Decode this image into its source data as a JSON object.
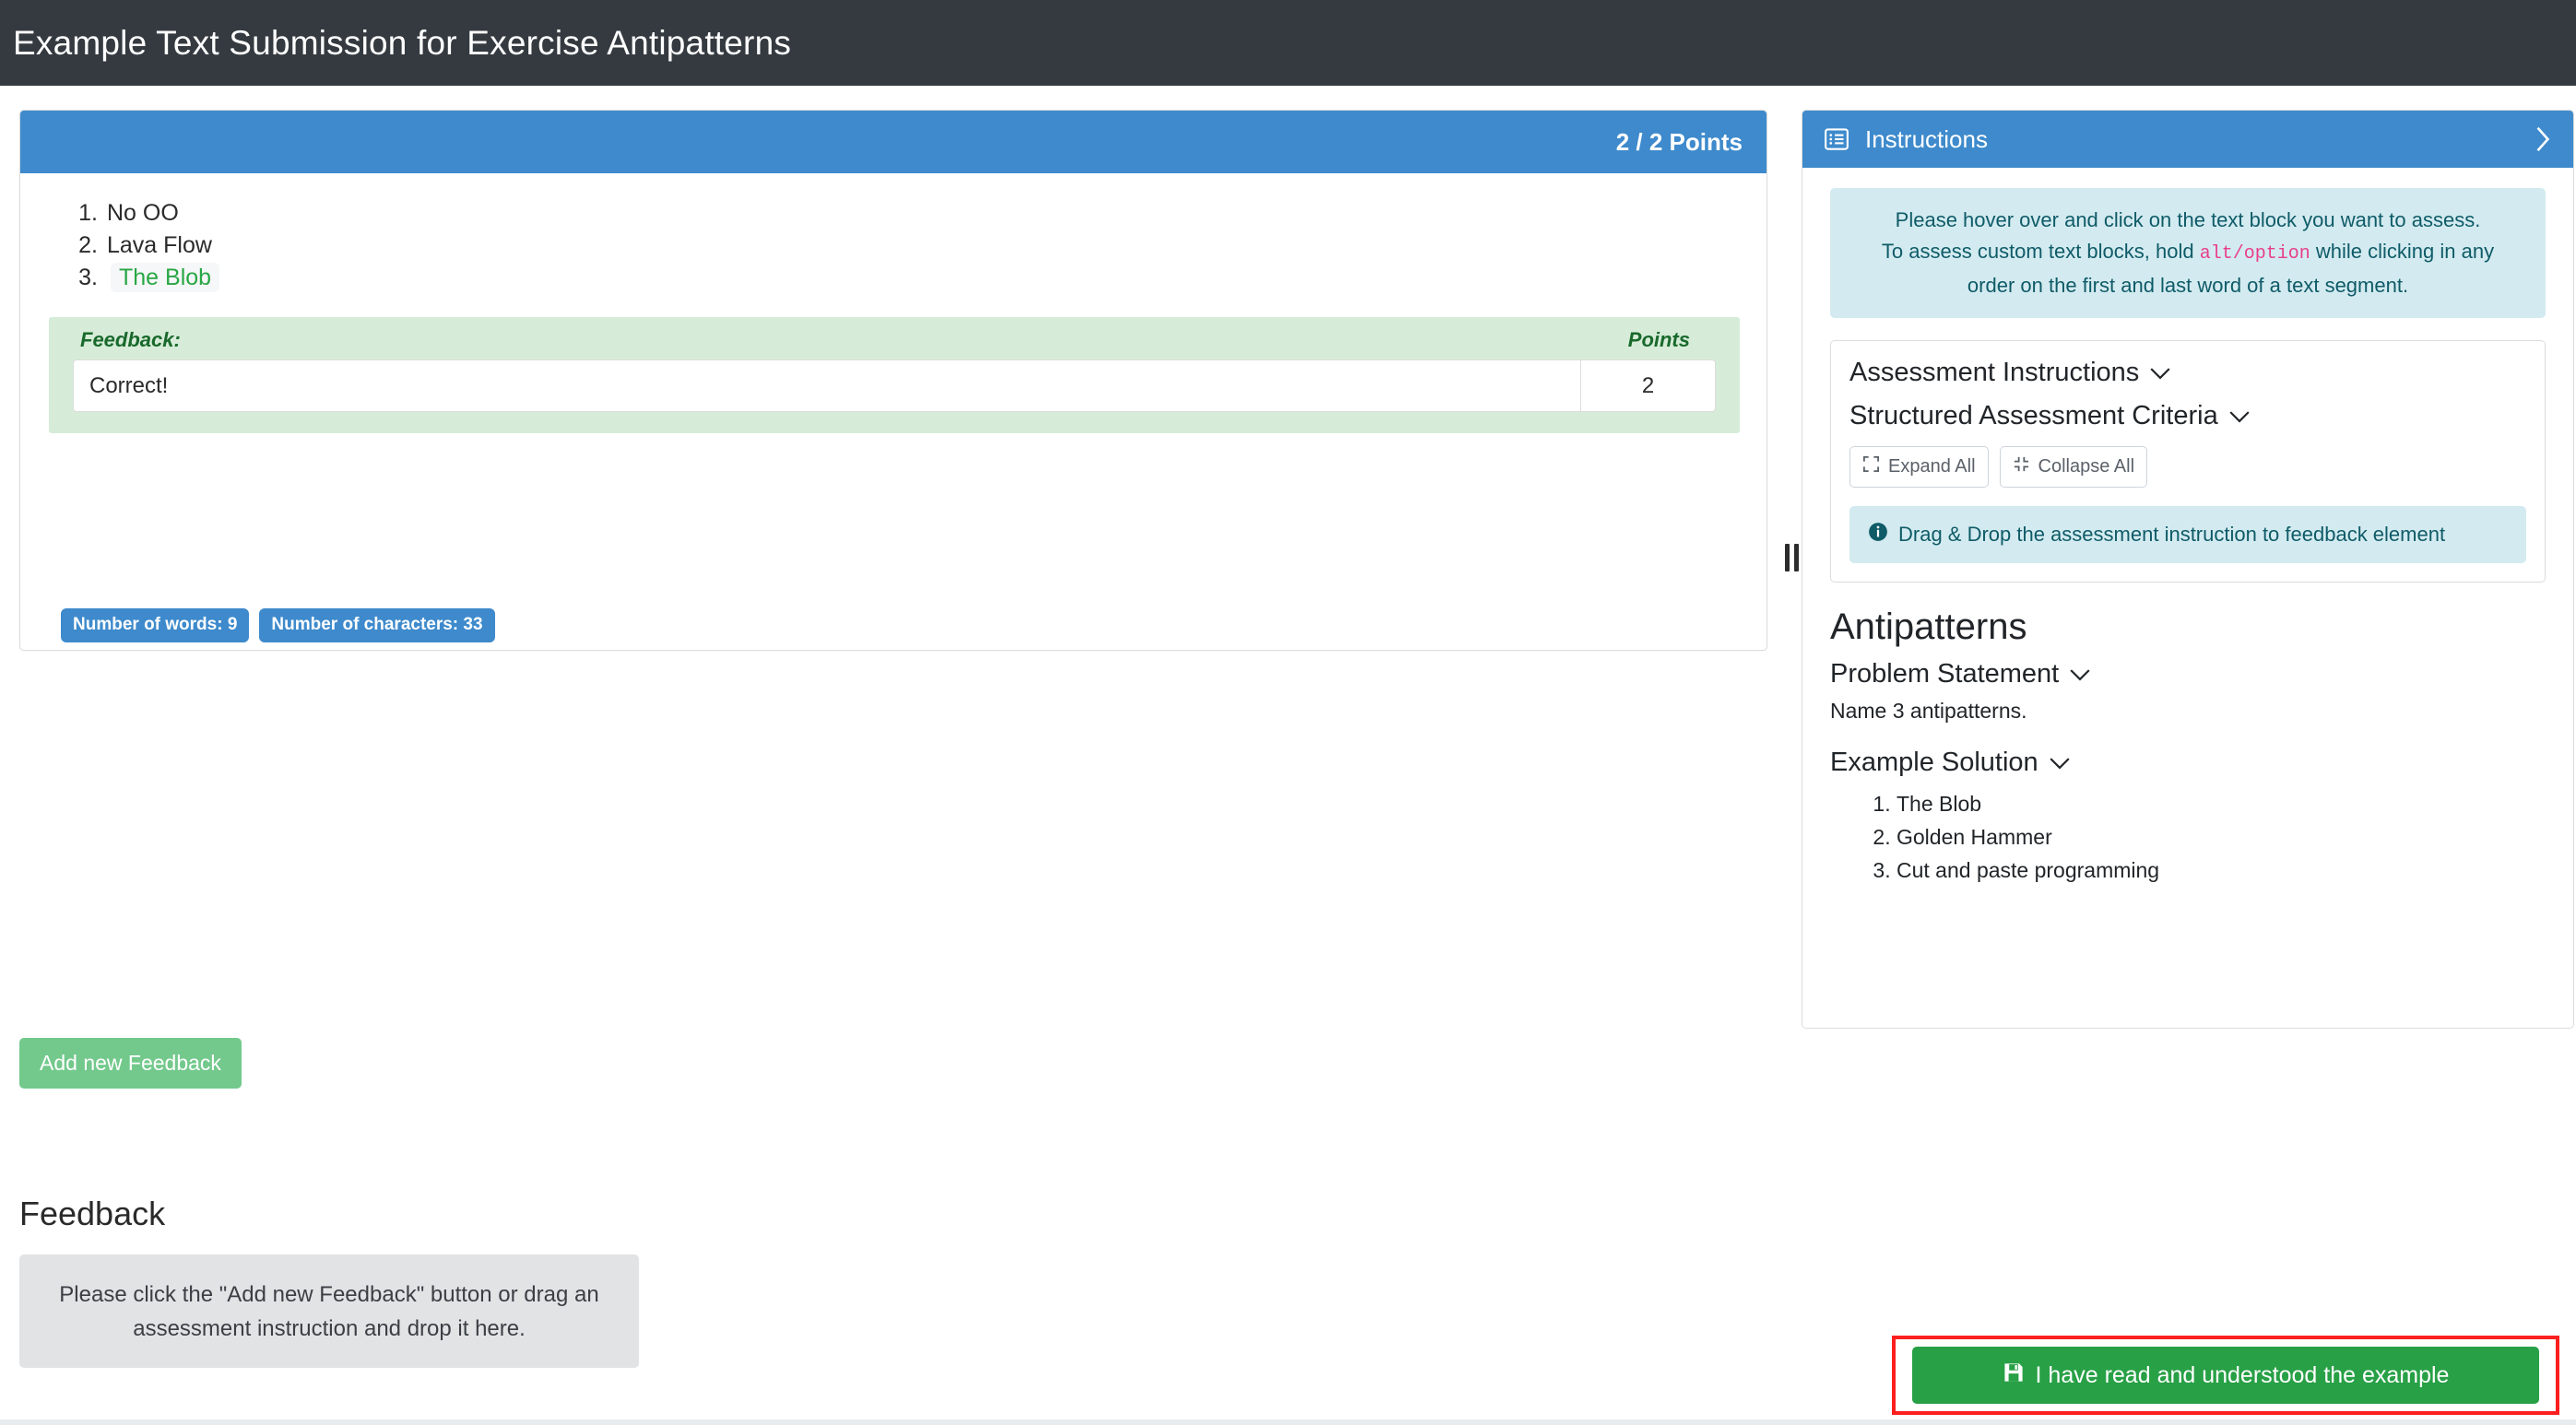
{
  "header": {
    "title": "Example Text Submission for Exercise Antipatterns"
  },
  "submission": {
    "points_label": "2 / 2 Points",
    "answers": [
      {
        "text": "No OO",
        "highlighted": false
      },
      {
        "text": "Lava Flow",
        "highlighted": false
      },
      {
        "text": "The Blob",
        "highlighted": true
      }
    ],
    "feedback": {
      "feedback_label": "Feedback:",
      "points_label": "Points",
      "feedback_text": "Correct!",
      "points_value": "2"
    },
    "counters": {
      "words": "Number of words: 9",
      "characters": "Number of characters: 33"
    }
  },
  "actions": {
    "add_feedback": "Add new Feedback",
    "feedback_heading": "Feedback",
    "feedback_dropzone": "Please click the \"Add new Feedback\" button or drag an assessment instruction and drop it here.",
    "confirm_button": "I have read and understood the example"
  },
  "instructions": {
    "panel_title": "Instructions",
    "hint_line1": "Please hover over and click on the text block you want to assess.",
    "hint_line2_pre": "To assess custom text blocks, hold ",
    "hint_key1": "alt",
    "hint_key_sep": "/",
    "hint_key2": "option",
    "hint_line2_post": " while clicking in any",
    "hint_line3": "order on the first and last word of a text segment.",
    "assessment_instructions_title": "Assessment Instructions",
    "structured_criteria_title": "Structured Assessment Criteria",
    "expand_all": "Expand All",
    "collapse_all": "Collapse All",
    "dragdrop_hint": "Drag & Drop the assessment instruction to feedback element"
  },
  "problem": {
    "title": "Antipatterns",
    "problem_statement_title": "Problem Statement",
    "problem_statement_text": "Name 3 antipatterns.",
    "example_solution_title": "Example Solution",
    "example_solution_items": [
      "The Blob",
      "Golden Hammer",
      "Cut and paste programming"
    ]
  },
  "colors": {
    "header_bg": "#343a40",
    "primary_blue": "#3e8acc",
    "success_green": "#28a046",
    "feedback_green_bg": "#d6ecd8",
    "info_bg": "#d3ebf0",
    "info_text": "#0f5b68",
    "code_pink": "#e83e8c",
    "highlight_red": "#fb1f1f"
  }
}
